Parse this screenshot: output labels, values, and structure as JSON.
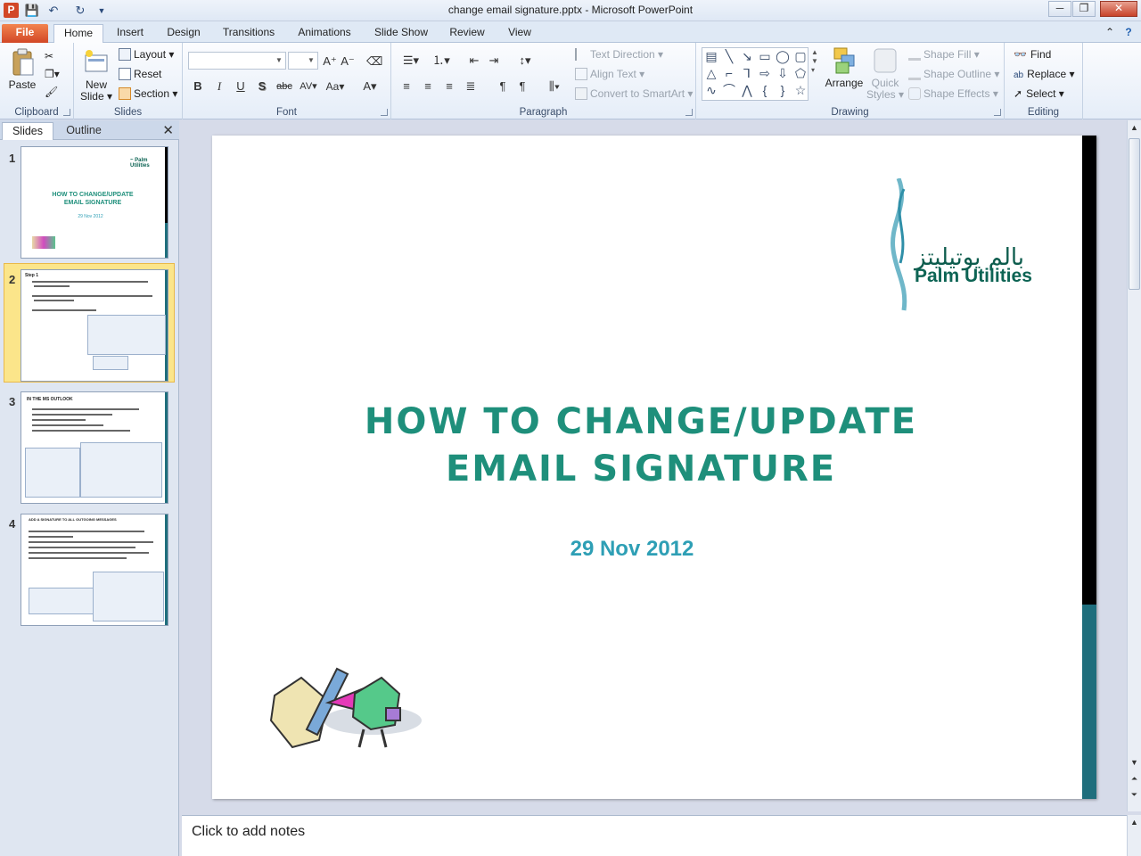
{
  "window": {
    "title": "change email signature.pptx - Microsoft PowerPoint",
    "app_icon": "P",
    "minimize": "─",
    "restore": "❐",
    "close": "✕"
  },
  "qat": {
    "save_icon": "save-icon",
    "undo_icon": "undo-icon",
    "redo_icon": "redo-icon"
  },
  "tabs": {
    "file": "File",
    "home": "Home",
    "insert": "Insert",
    "design": "Design",
    "transitions": "Transitions",
    "animations": "Animations",
    "slide_show": "Slide Show",
    "review": "Review",
    "view": "View"
  },
  "ribbon": {
    "clipboard": {
      "label": "Clipboard",
      "paste": "Paste"
    },
    "slides": {
      "label": "Slides",
      "new_slide": "New Slide ▾",
      "layout": "Layout ▾",
      "reset": "Reset",
      "section": "Section ▾"
    },
    "font": {
      "label": "Font",
      "bold": "B",
      "italic": "I",
      "underline": "U",
      "shadow": "S",
      "strike": "abc",
      "spacing": "AV▾",
      "case": "Aa▾",
      "color": "A▾",
      "grow": "A⁺",
      "shrink": "A⁻"
    },
    "paragraph": {
      "label": "Paragraph",
      "text_direction": "Text Direction ▾",
      "align_text": "Align Text ▾",
      "convert_smartart": "Convert to SmartArt ▾"
    },
    "drawing": {
      "label": "Drawing",
      "arrange": "Arrange",
      "quick_styles": "Quick Styles ▾",
      "shape_fill": "Shape Fill ▾",
      "shape_outline": "Shape Outline ▾",
      "shape_effects": "Shape Effects ▾"
    },
    "editing": {
      "label": "Editing",
      "find": "Find",
      "replace": "Replace ▾",
      "select": "Select ▾"
    }
  },
  "panel": {
    "tabs": {
      "slides": "Slides",
      "outline": "Outline"
    },
    "close": "✕",
    "thumbnails": [
      {
        "number": "1",
        "title": "HOW TO  CHANGE/UPDATE",
        "title2": "EMAIL   SIGNATURE",
        "date": "29 Nov 2012"
      },
      {
        "number": "2",
        "heading": "Step 1"
      },
      {
        "number": "3",
        "heading": "IN THE MS OUTLOOK"
      },
      {
        "number": "4",
        "heading": "ADD A SIGNATURE TO ALL OUTGOING MESSAGES"
      }
    ]
  },
  "slide": {
    "logo_arabic": "بالم يوتيليتز",
    "logo_text": "Palm Utilities",
    "title_line1": "HOW TO CHANGE/UPDATE",
    "title_line2": "EMAIL SIGNATURE",
    "date": "29 Nov 2012"
  },
  "notes": {
    "placeholder": "Click to add notes"
  },
  "colors": {
    "accent_title": "#1e8f7b",
    "date": "#2e9fb5",
    "file_tab": "#d24726",
    "slide_bar": "#1f6e7c"
  }
}
